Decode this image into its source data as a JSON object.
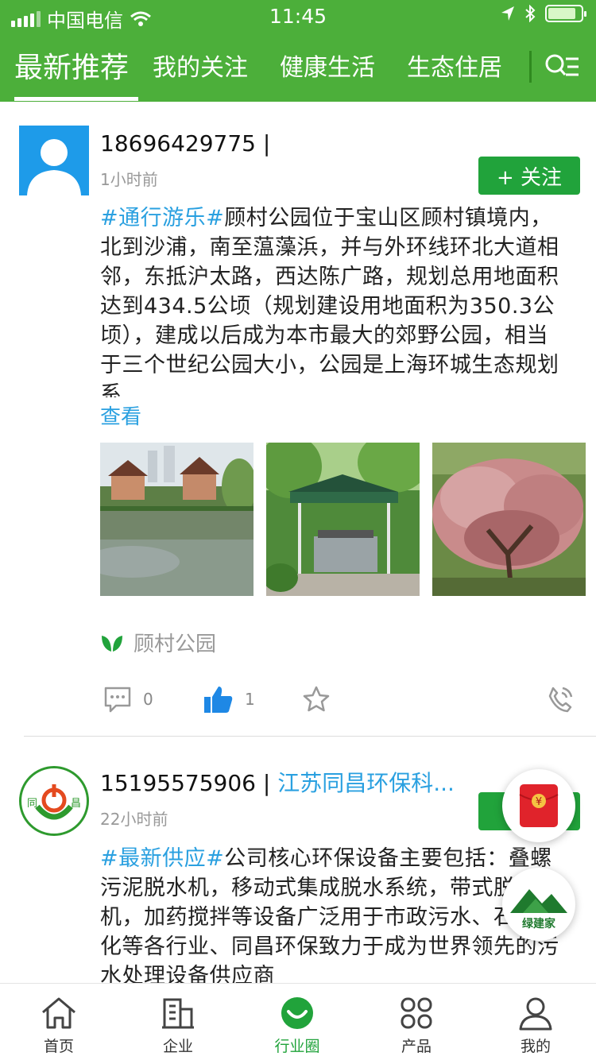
{
  "status_bar": {
    "carrier": "中国电信",
    "time": "11:45"
  },
  "colors": {
    "brand_green": "#4caf3a",
    "follow_green": "#21a33b",
    "link_blue": "#2aa0e0"
  },
  "top_tabs": [
    {
      "label": "最新推荐",
      "active": true
    },
    {
      "label": "我的关注",
      "active": false
    },
    {
      "label": "健康生活",
      "active": false
    },
    {
      "label": "生态住居",
      "active": false
    }
  ],
  "posts": [
    {
      "username": "18696429775 |",
      "time": "1小时前",
      "follow_label": "+ 关注",
      "hashtag": "#通行游乐#",
      "body": "顾村公园位于宝山区顾村镇境内，北到沙浦，南至蕰藻浜，并与外环线环北大道相邻，东抵沪太路，西达陈广路，规划总用地面积达到434.5公顷（规划建设用地面积为350.3公顷），建成以后成为本市最大的郊野公园，相当于三个世纪公园大小，公园是上海环城生态规划系",
      "more_label": "查看",
      "images": [
        "villas-by-lake-image",
        "gazebo-garden-image",
        "cherry-blossom-image"
      ],
      "location": "顾村公园",
      "comments": "0",
      "likes": "1"
    },
    {
      "username": "15195575906 |",
      "company": "江苏同昌环保科...",
      "logo_text_left": "同",
      "logo_text_right": "昌",
      "time": "22小时前",
      "hashtag": "#最新供应#",
      "body": "公司核心环保设备主要包括：叠螺污泥脱水机，移动式集成脱水系统，带式脱水机，加药搅拌等设备广泛用于市政污水、石油石化等各行业、同昌环保致力于成为世界领先的污水处理设备供应商"
    }
  ],
  "floating": {
    "red_packet_symbol": "¥",
    "brand_badge": "绿建家"
  },
  "bottom_nav": [
    {
      "label": "首页",
      "icon": "home-icon"
    },
    {
      "label": "企业",
      "icon": "building-icon"
    },
    {
      "label": "行业圈",
      "icon": "circle-icon",
      "active": true
    },
    {
      "label": "产品",
      "icon": "grid-icon"
    },
    {
      "label": "我的",
      "icon": "person-icon"
    }
  ]
}
